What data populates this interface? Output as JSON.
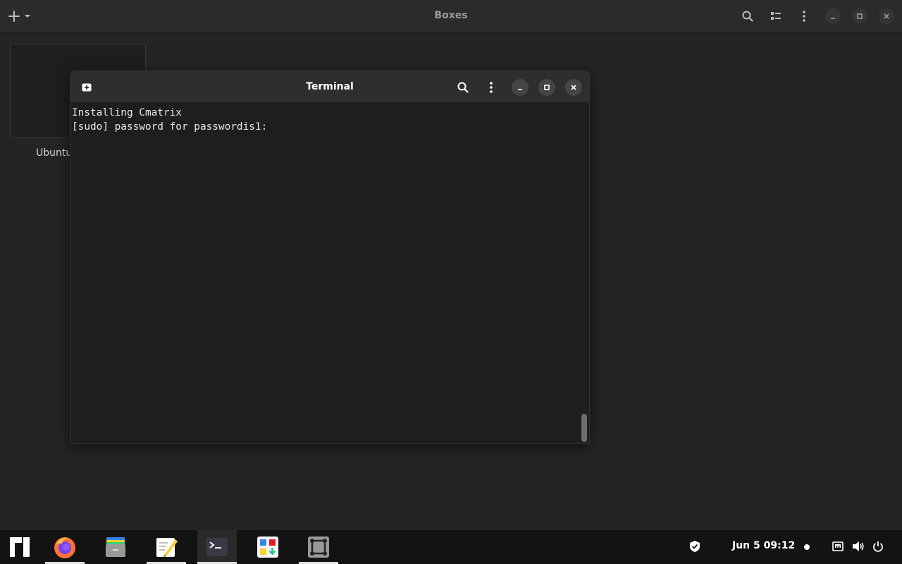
{
  "boxes": {
    "title": "Boxes",
    "vm_name": "Ubuntu"
  },
  "terminal": {
    "title": "Terminal",
    "lines": [
      "Installing Cmatrix",
      "[sudo] password for passwordis1:"
    ]
  },
  "taskbar": {
    "apps": [
      {
        "name": "Firefox",
        "running": true
      },
      {
        "name": "Files",
        "running": false
      },
      {
        "name": "Text Editor",
        "running": true
      },
      {
        "name": "Terminal",
        "running": true,
        "active": true
      },
      {
        "name": "Software",
        "running": false
      },
      {
        "name": "Boxes",
        "running": true
      }
    ],
    "clock": "Jun 5  09:12"
  },
  "colors": {
    "background": "#242424",
    "header": "#2b2b2b",
    "taskbar": "#131313",
    "firefox_orange": "#ff7139",
    "text_editor_yellow": "#f6d32d"
  }
}
